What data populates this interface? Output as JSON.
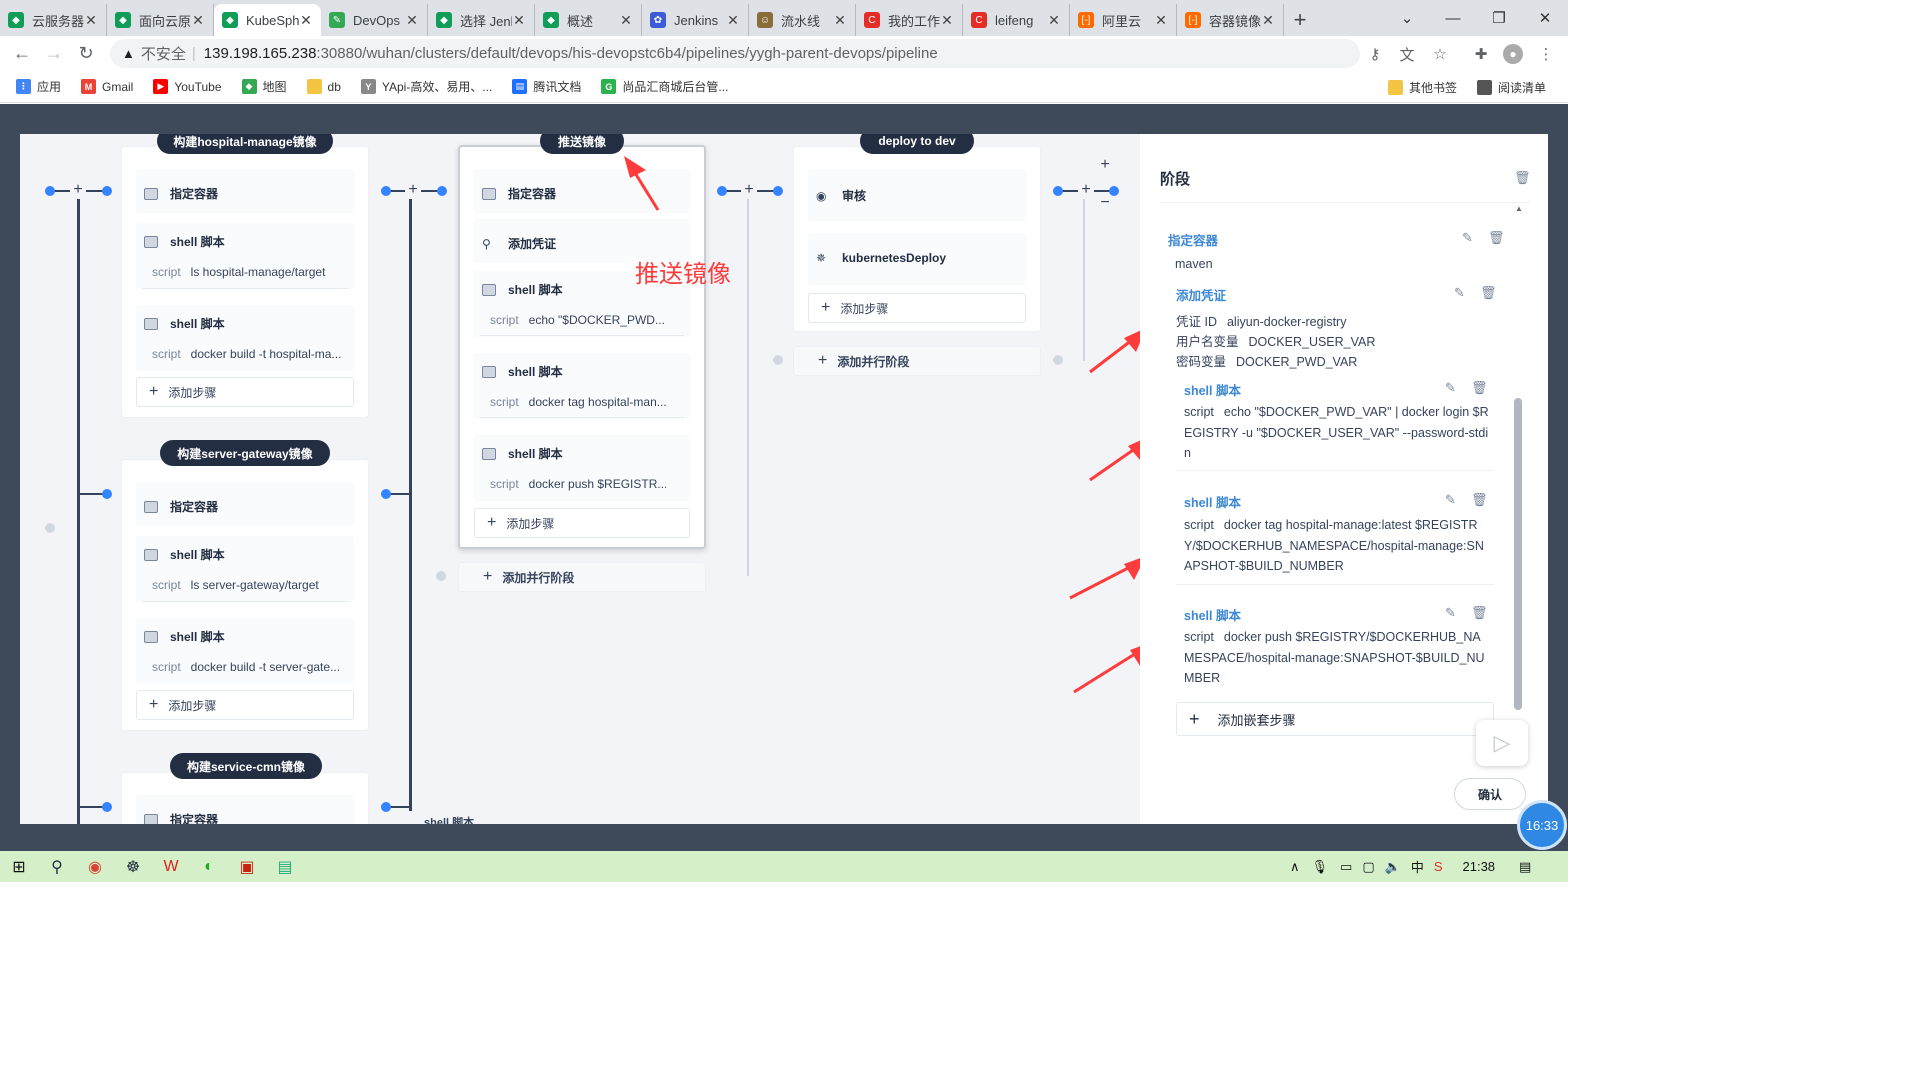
{
  "browser": {
    "tabs": [
      {
        "title": "云服务器",
        "color": "#0f9d58",
        "glyph": "◆"
      },
      {
        "title": "面向云原",
        "color": "#0f9d58",
        "glyph": "◆"
      },
      {
        "title": "KubeSphere",
        "color": "#0f9d58",
        "glyph": "◆",
        "active": true
      },
      {
        "title": "DevOps",
        "color": "#34a853",
        "glyph": "✎"
      },
      {
        "title": "选择 Jenkins",
        "color": "#0f9d58",
        "glyph": "◆"
      },
      {
        "title": "概述",
        "color": "#0f9d58",
        "glyph": "◆"
      },
      {
        "title": "Jenkins",
        "color": "#3b5bd9",
        "glyph": "✿"
      },
      {
        "title": "流水线",
        "color": "#8a6d3b",
        "glyph": "☺"
      },
      {
        "title": "我的工作台",
        "color": "#e52d27",
        "glyph": "C"
      },
      {
        "title": "leifeng",
        "color": "#e52d27",
        "glyph": "C"
      },
      {
        "title": "阿里云",
        "color": "#ff6a00",
        "glyph": "[-]"
      },
      {
        "title": "容器镜像",
        "color": "#ff6a00",
        "glyph": "[-]"
      }
    ],
    "close_glyph": "✕",
    "new_tab": "+",
    "address": {
      "insecure_label": "不安全",
      "host": "139.198.165.238",
      "path": ":30880/wuhan/clusters/default/devops/his-devopstc6b4/pipelines/yygh-parent-devops/pipeline"
    },
    "bookmarks": [
      {
        "label": "应用",
        "color": "#4285f4",
        "glyph": "⋮"
      },
      {
        "label": "Gmail",
        "color": "#ea4335",
        "glyph": "M"
      },
      {
        "label": "YouTube",
        "color": "#ff0000",
        "glyph": "▶"
      },
      {
        "label": "地图",
        "color": "#34a853",
        "glyph": "◆"
      },
      {
        "label": "db",
        "color": "#f4c542",
        "glyph": ""
      },
      {
        "label": "YApi-高效、易用、...",
        "color": "#888888",
        "glyph": "Y"
      },
      {
        "label": "腾讯文档",
        "color": "#1e6fff",
        "glyph": "▤"
      },
      {
        "label": "尚品汇商城后台管...",
        "color": "#2bb24c",
        "glyph": "G"
      }
    ],
    "bookmarks_right": [
      {
        "label": "其他书签",
        "color": "#f4c542"
      },
      {
        "label": "阅读清单",
        "color": "#555555"
      }
    ]
  },
  "pipeline": {
    "stages": [
      {
        "title": "构建hospital-manage镜像",
        "steps": [
          {
            "name": "指定容器"
          },
          {
            "name": "shell 脚本",
            "script": "ls hospital-manage/target"
          },
          {
            "name": "shell 脚本",
            "script": "docker build -t hospital-ma..."
          }
        ],
        "add_step": "添加步骤"
      },
      {
        "title": "构建server-gateway镜像",
        "steps": [
          {
            "name": "指定容器"
          },
          {
            "name": "shell 脚本",
            "script": "ls server-gateway/target"
          },
          {
            "name": "shell 脚本",
            "script": "docker build -t server-gate..."
          }
        ],
        "add_step": "添加步骤"
      },
      {
        "title": "构建service-cmn镜像",
        "steps": [
          {
            "name": "指定容器"
          }
        ]
      },
      {
        "title": "推送镜像",
        "steps": [
          {
            "name": "指定容器"
          },
          {
            "name": "添加凭证"
          },
          {
            "name": "shell 脚本",
            "script": "echo \"$DOCKER_PWD..."
          },
          {
            "name": "shell 脚本",
            "script": "docker tag hospital-man..."
          },
          {
            "name": "shell 脚本",
            "script": "docker push $REGISTR..."
          }
        ],
        "add_step": "添加步骤",
        "add_parallel": "添加并行阶段"
      },
      {
        "title": "deploy to dev",
        "steps": [
          {
            "name": "审核"
          },
          {
            "name": "kubernetesDeploy"
          }
        ],
        "add_step": "添加步骤",
        "add_parallel": "添加并行阶段"
      }
    ],
    "script_label": "script",
    "annotation": "推送镜像",
    "below_text": "shell 脚本"
  },
  "panel": {
    "title": "阶段",
    "container": {
      "label": "指定容器",
      "value": "maven"
    },
    "credential": {
      "label": "添加凭证",
      "rows": [
        {
          "key": "凭证 ID",
          "value": "aliyun-docker-registry"
        },
        {
          "key": "用户名变量",
          "value": "DOCKER_USER_VAR"
        },
        {
          "key": "密码变量",
          "value": "DOCKER_PWD_VAR"
        }
      ]
    },
    "shells": [
      {
        "label": "shell 脚本",
        "script": "echo \"$DOCKER_PWD_VAR\" | docker login $REGISTRY -u \"$DOCKER_USER_VAR\" --password-stdin"
      },
      {
        "label": "shell 脚本",
        "script": "docker tag hospital-manage:latest $REGISTRY/$DOCKERHUB_NAMESPACE/hospital-manage:SNAPSHOT-$BUILD_NUMBER"
      },
      {
        "label": "shell 脚本",
        "script": "docker push $REGISTRY/$DOCKERHUB_NAMESPACE/hospital-manage:SNAPSHOT-$BUILD_NUMBER"
      }
    ],
    "script_label": "script",
    "add_nested": "添加嵌套步骤",
    "confirm": "确认"
  },
  "overlay": {
    "clock": "16:33"
  },
  "taskbar": {
    "time": "21:38",
    "ime": "中"
  },
  "colors": {
    "accent": "#3385ff",
    "dark": "#242e42",
    "annotation": "#ff3b3b"
  }
}
